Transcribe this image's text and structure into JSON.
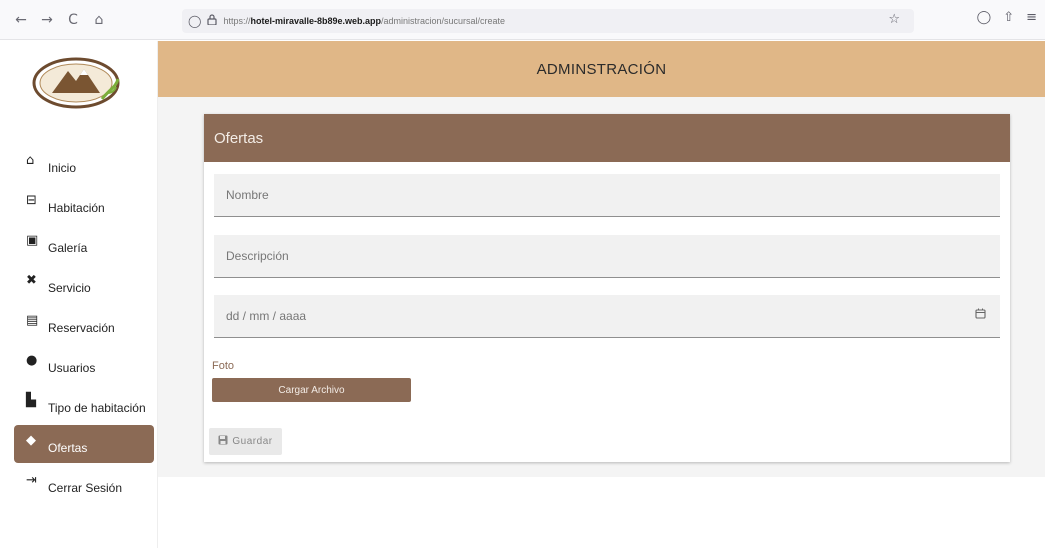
{
  "browser": {
    "back_icon": "←",
    "forward_icon": "→",
    "reload_icon": "C",
    "home_icon": "⌂",
    "shield_icon": "◯",
    "lock_icon": "🔒",
    "url_prefix": "https://",
    "url_host": "hotel-miravalle-8b89e.web.app",
    "url_path": "/administracion/sucursal/create",
    "star_icon": "☆",
    "pocket_icon": "◯",
    "extensions_icon": "⇧",
    "menu_icon": "≡"
  },
  "logo": {
    "top_text": "Hotel Miravalle de",
    "bottom_text": "Machachi"
  },
  "sidebar": {
    "items": [
      {
        "icon": "⌂",
        "label": "Inicio"
      },
      {
        "icon": "⊟",
        "label": "Habitación"
      },
      {
        "icon": "▣",
        "label": "Galería"
      },
      {
        "icon": "✖",
        "label": "Servicio"
      },
      {
        "icon": "▤",
        "label": "Reservación"
      },
      {
        "icon": "●",
        "label": "Usuarios"
      },
      {
        "icon": "▙",
        "label": "Tipo de habitación"
      },
      {
        "icon": "◆",
        "label": "Ofertas"
      },
      {
        "icon": "⇥",
        "label": "Cerrar Sesión"
      }
    ]
  },
  "header": {
    "title": "ADMINSTRACIÓN"
  },
  "card": {
    "title": "Ofertas",
    "fields": {
      "nombre_placeholder": "Nombre",
      "descripcion_placeholder": "Descripción",
      "fecha_placeholder": "dd / mm / aaaa",
      "calendar_icon": "▭"
    },
    "foto_label": "Foto",
    "upload_label": "Cargar Archivo",
    "save_icon": "▣",
    "save_label": "Guardar"
  },
  "colors": {
    "header_bg": "#e0b787",
    "accent": "#8b6a55"
  }
}
